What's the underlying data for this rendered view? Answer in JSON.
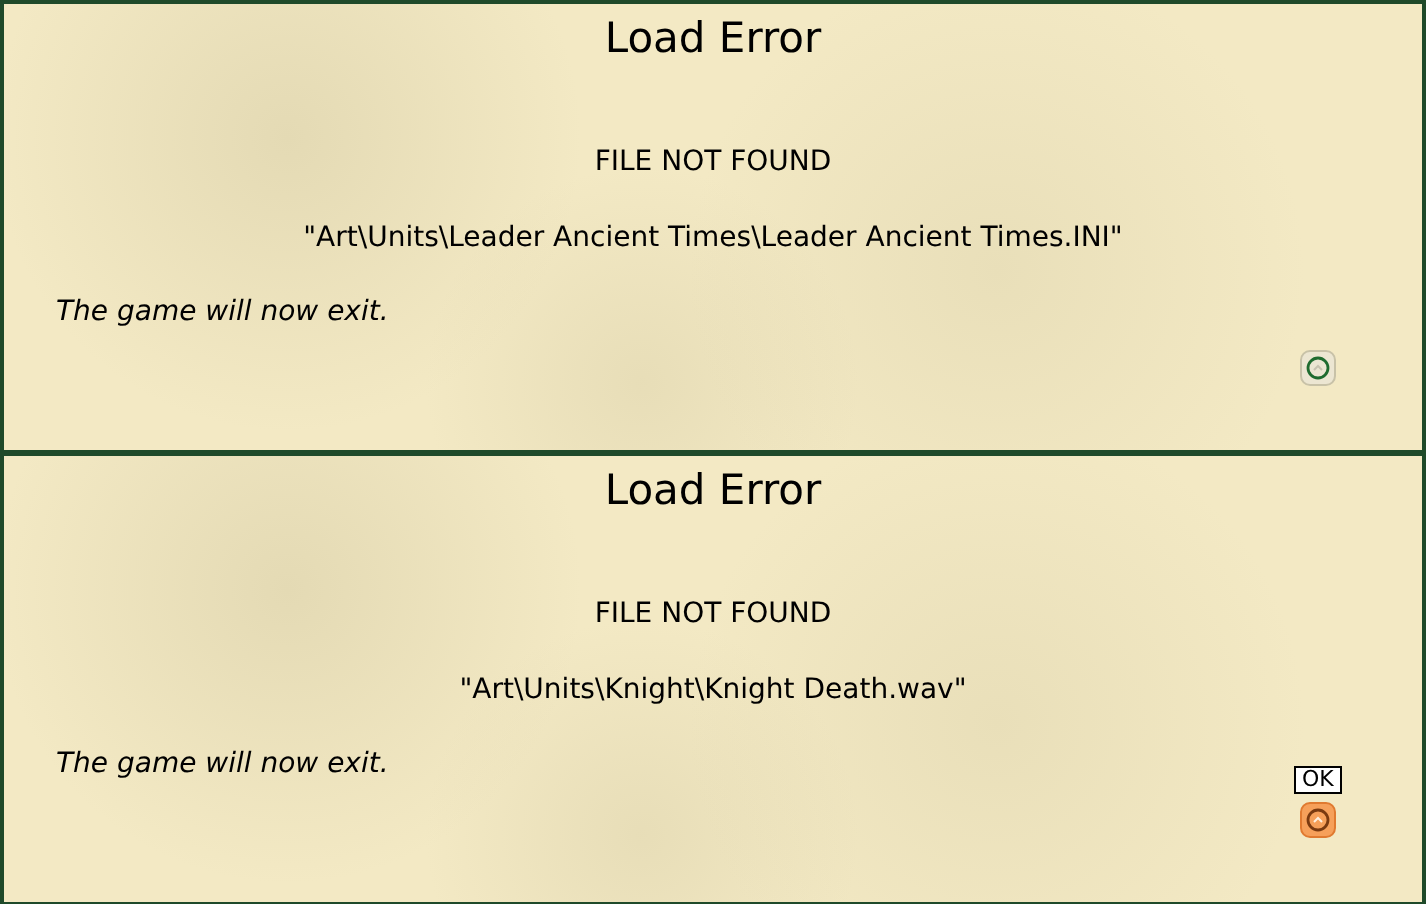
{
  "dialogs": [
    {
      "title": "Load Error",
      "heading": "FILE NOT FOUND",
      "path": "\"Art\\Units\\Leader Ancient Times\\Leader Ancient Times.INI\"",
      "message": "The game will now exit.",
      "ok_button": {
        "hovered": false
      }
    },
    {
      "title": "Load Error",
      "heading": "FILE NOT FOUND",
      "path": "\"Art\\Units\\Knight\\Knight Death.wav\"",
      "message": "The game will now exit.",
      "ok_button": {
        "hovered": true,
        "tooltip": "OK"
      }
    }
  ]
}
